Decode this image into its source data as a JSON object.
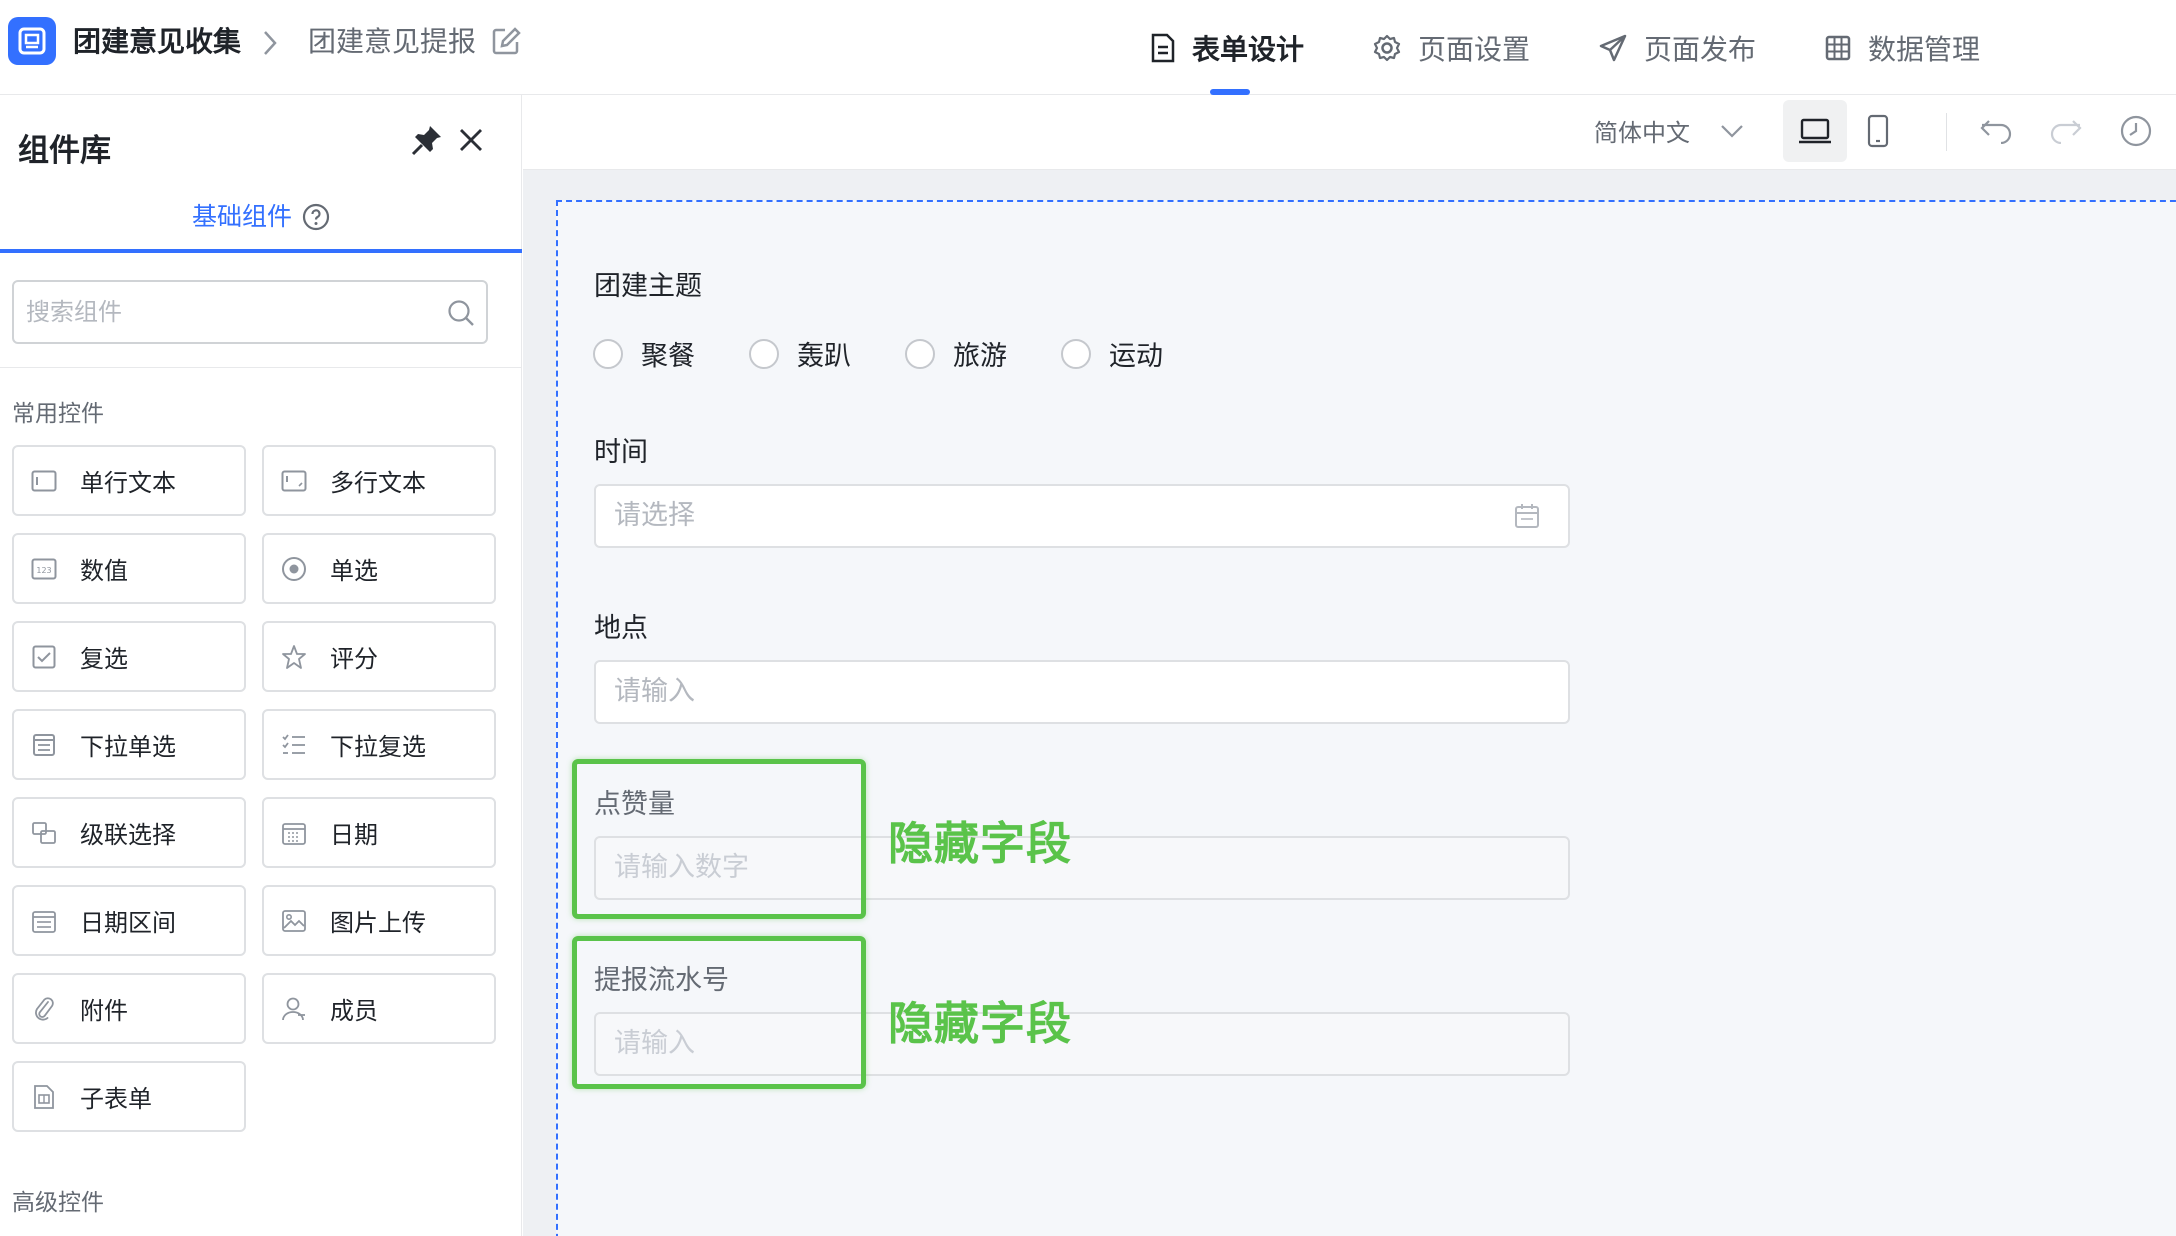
{
  "header": {
    "app_name": "团建意见收集",
    "separator": ">",
    "page_name": "团建意见提报",
    "tabs": [
      {
        "label": "表单设计",
        "icon": "document-icon",
        "active": true
      },
      {
        "label": "页面设置",
        "icon": "gear-icon",
        "active": false
      },
      {
        "label": "页面发布",
        "icon": "send-icon",
        "active": false
      },
      {
        "label": "数据管理",
        "icon": "table-grid-icon",
        "active": false
      }
    ],
    "accent_color": "#3370ff"
  },
  "sidebar": {
    "title": "组件库",
    "tab_label": "基础组件",
    "search_placeholder": "搜索组件",
    "section_common": "常用控件",
    "section_advanced": "高级控件",
    "components": [
      {
        "label": "单行文本",
        "icon": "single-line-text-icon"
      },
      {
        "label": "多行文本",
        "icon": "multi-line-text-icon"
      },
      {
        "label": "数值",
        "icon": "number-icon"
      },
      {
        "label": "单选",
        "icon": "radio-icon"
      },
      {
        "label": "复选",
        "icon": "checkbox-icon"
      },
      {
        "label": "评分",
        "icon": "star-icon"
      },
      {
        "label": "下拉单选",
        "icon": "dropdown-single-icon"
      },
      {
        "label": "下拉复选",
        "icon": "dropdown-multi-icon"
      },
      {
        "label": "级联选择",
        "icon": "cascade-icon"
      },
      {
        "label": "日期",
        "icon": "calendar-icon"
      },
      {
        "label": "日期区间",
        "icon": "date-range-icon"
      },
      {
        "label": "图片上传",
        "icon": "image-upload-icon"
      },
      {
        "label": "附件",
        "icon": "paperclip-icon"
      },
      {
        "label": "成员",
        "icon": "member-icon"
      },
      {
        "label": "子表单",
        "icon": "subform-icon"
      }
    ]
  },
  "toolbar": {
    "language": "简体中文"
  },
  "form": {
    "fields": {
      "theme": {
        "label": "团建主题",
        "options": [
          "聚餐",
          "轰趴",
          "旅游",
          "运动"
        ]
      },
      "time": {
        "label": "时间",
        "placeholder": "请选择"
      },
      "location": {
        "label": "地点",
        "placeholder": "请输入"
      },
      "likes": {
        "label": "点赞量",
        "placeholder": "请输入数字"
      },
      "serial": {
        "label": "提报流水号",
        "placeholder": "请输入"
      }
    },
    "annotation_text": "隐藏字段",
    "annotation_color": "#5ac34a"
  }
}
